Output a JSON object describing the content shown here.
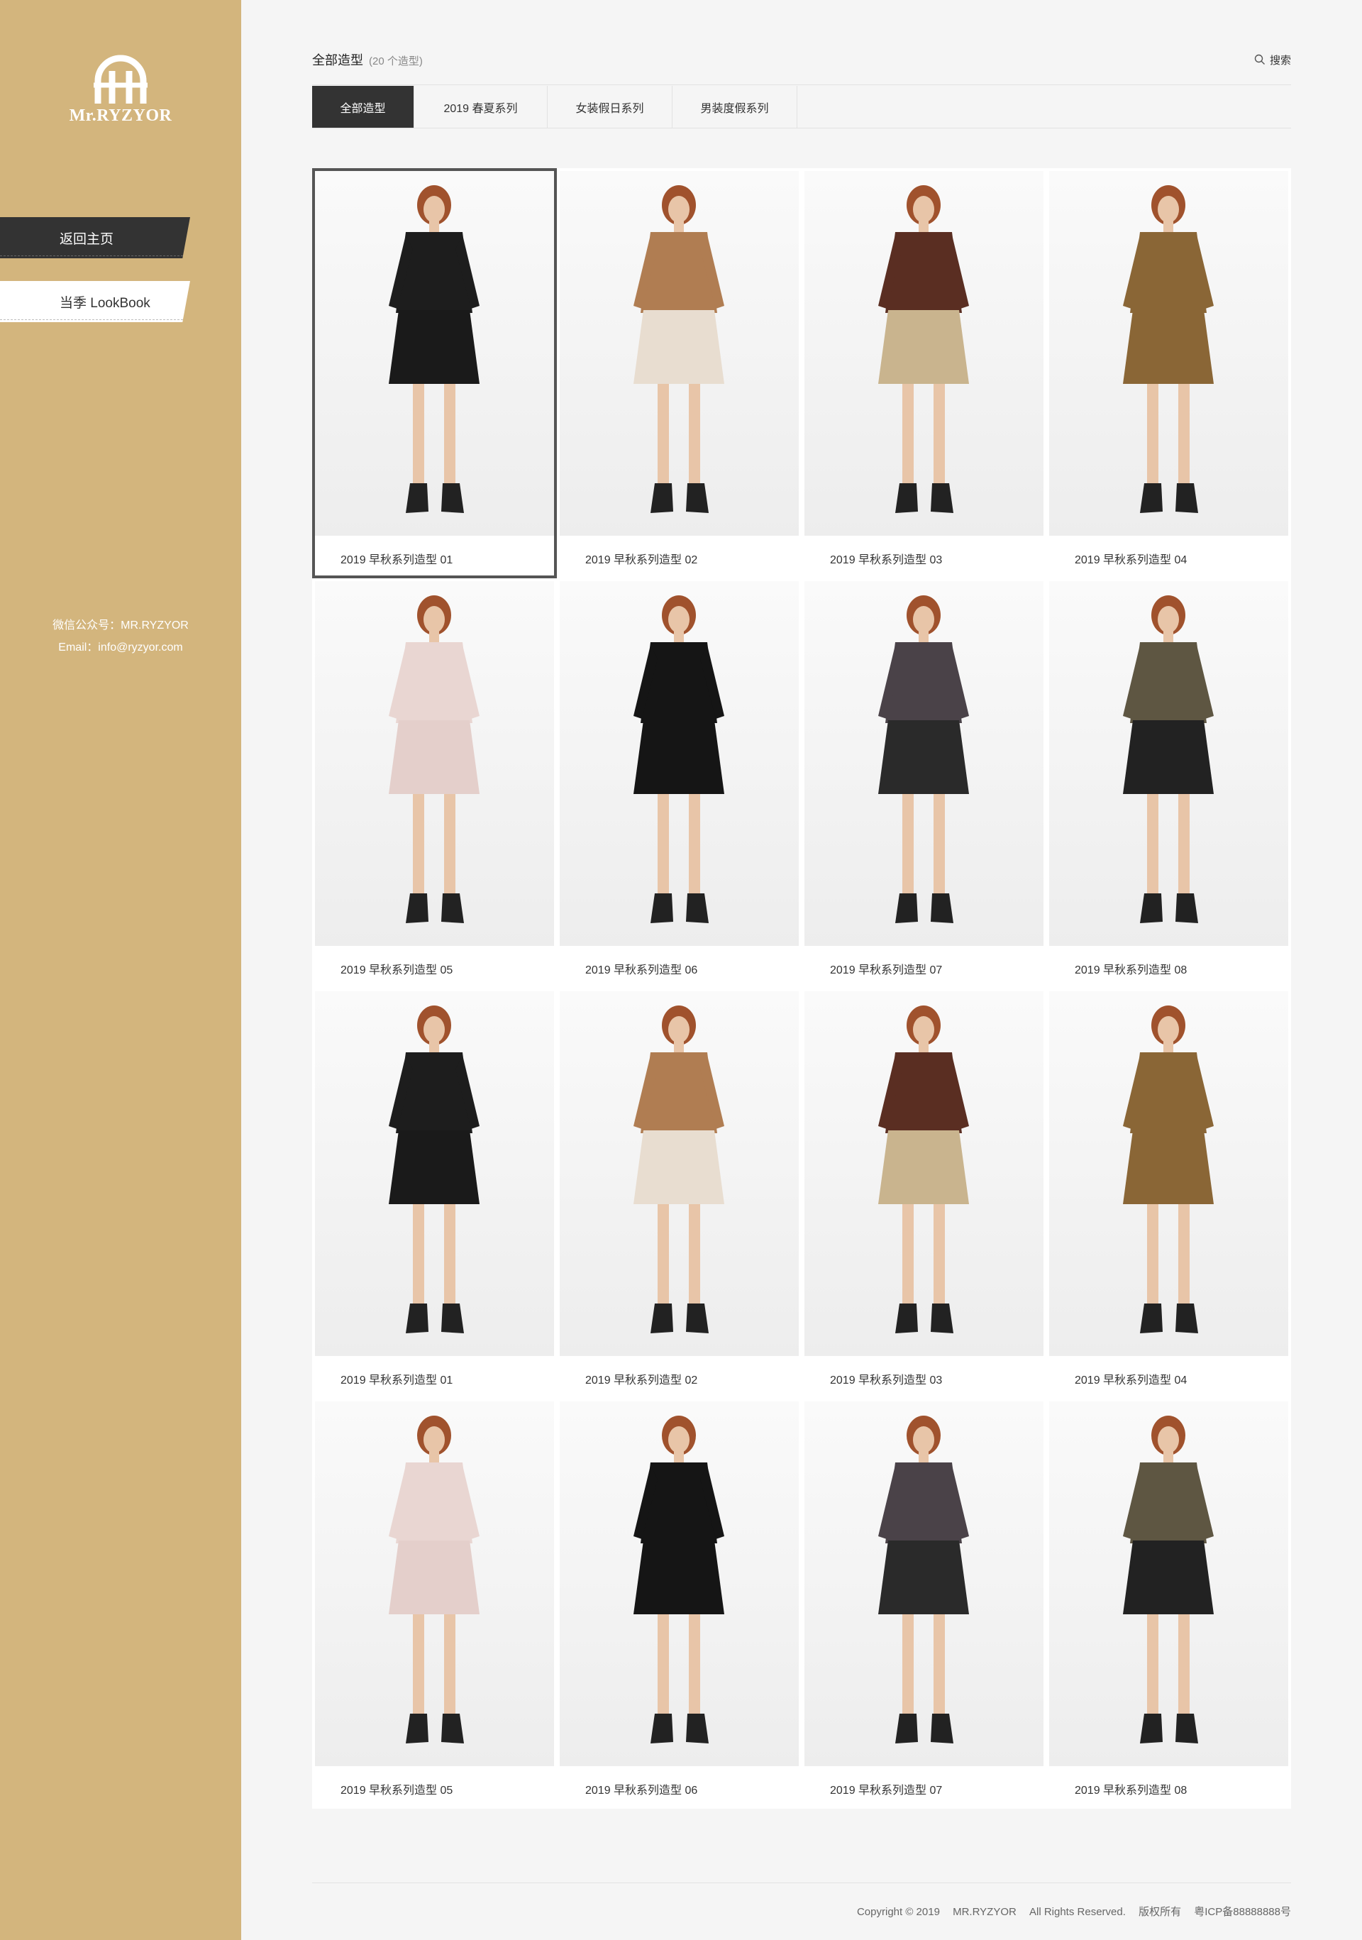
{
  "sidebar": {
    "brand": "Mr.RYZYOR",
    "nav": [
      {
        "label": "返回主页"
      },
      {
        "label": "当季 LookBook"
      }
    ],
    "contact": {
      "wechat": "微信公众号：MR.RYZYOR",
      "email": "Email：info@ryzyor.com"
    }
  },
  "header": {
    "title": "全部造型",
    "count": "(20 个造型)",
    "search_label": "搜索"
  },
  "tabs": [
    {
      "label": "全部造型",
      "active": true
    },
    {
      "label": "2019 春夏系列",
      "active": false
    },
    {
      "label": "女装假日系列",
      "active": false
    },
    {
      "label": "男装度假系列",
      "active": false
    }
  ],
  "looks": [
    {
      "caption": "2019 早秋系列造型 01",
      "top": "#1d1d1d",
      "bottom": "#1a1a1a",
      "selected": true
    },
    {
      "caption": "2019 早秋系列造型 02",
      "top": "#b07d52",
      "bottom": "#e8ddd0",
      "selected": false
    },
    {
      "caption": "2019 早秋系列造型 03",
      "top": "#5a2e22",
      "bottom": "#c9b48e",
      "selected": false
    },
    {
      "caption": "2019 早秋系列造型 04",
      "top": "#8a6636",
      "bottom": "#8a6636",
      "selected": false
    },
    {
      "caption": "2019 早秋系列造型 05",
      "top": "#e9d6d2",
      "bottom": "#e4cfcb",
      "selected": false
    },
    {
      "caption": "2019 早秋系列造型 06",
      "top": "#151515",
      "bottom": "#151515",
      "selected": false
    },
    {
      "caption": "2019 早秋系列造型 07",
      "top": "#4a4248",
      "bottom": "#2a2a2a",
      "selected": false
    },
    {
      "caption": "2019 早秋系列造型 08",
      "top": "#5e5642",
      "bottom": "#222222",
      "selected": false
    },
    {
      "caption": "2019 早秋系列造型 01",
      "top": "#1d1d1d",
      "bottom": "#1a1a1a",
      "selected": false
    },
    {
      "caption": "2019 早秋系列造型 02",
      "top": "#b07d52",
      "bottom": "#e8ddd0",
      "selected": false
    },
    {
      "caption": "2019 早秋系列造型 03",
      "top": "#5a2e22",
      "bottom": "#c9b48e",
      "selected": false
    },
    {
      "caption": "2019 早秋系列造型 04",
      "top": "#8a6636",
      "bottom": "#8a6636",
      "selected": false
    },
    {
      "caption": "2019 早秋系列造型 05",
      "top": "#e9d6d2",
      "bottom": "#e4cfcb",
      "selected": false
    },
    {
      "caption": "2019 早秋系列造型 06",
      "top": "#151515",
      "bottom": "#151515",
      "selected": false
    },
    {
      "caption": "2019 早秋系列造型 07",
      "top": "#4a4248",
      "bottom": "#2a2a2a",
      "selected": false
    },
    {
      "caption": "2019 早秋系列造型 08",
      "top": "#5e5642",
      "bottom": "#222222",
      "selected": false
    }
  ],
  "footer": {
    "copyright": "Copyright © 2019",
    "company": "MR.RYZYOR",
    "rights": "All Rights Reserved.",
    "owner": "版权所有",
    "icp": "粤ICP备88888888号"
  },
  "colors": {
    "sidebar_bg": "#d3b57d",
    "active_tab": "#333333",
    "page_bg": "#f5f5f5"
  }
}
